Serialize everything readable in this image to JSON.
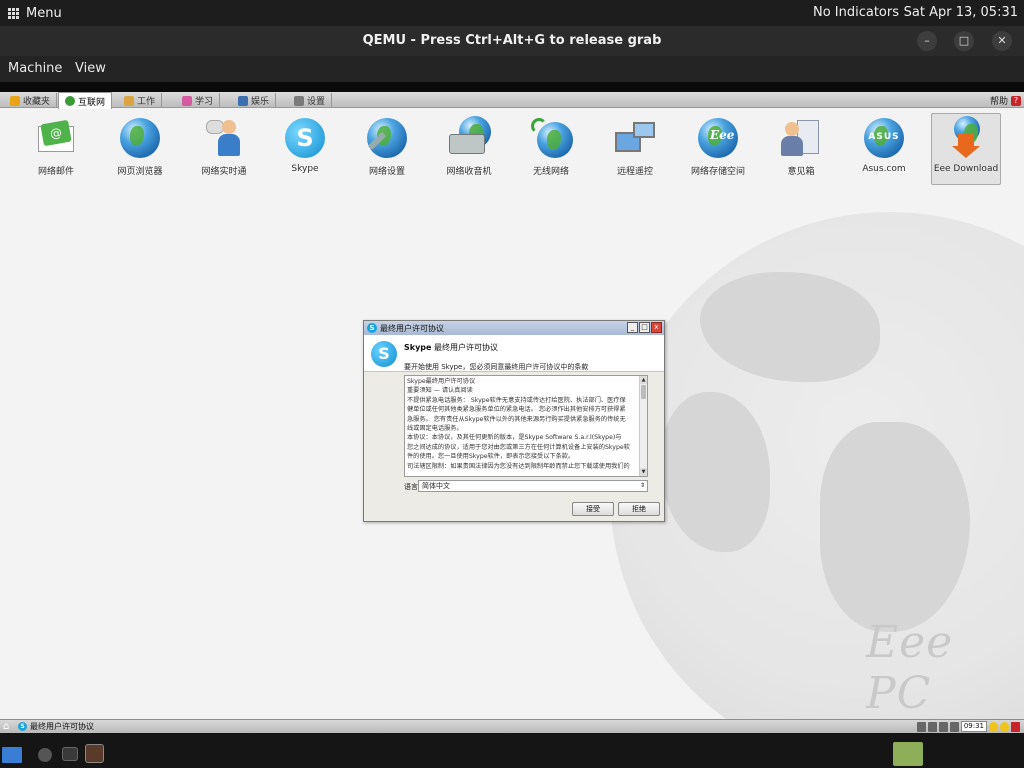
{
  "host_panel": {
    "menu_label": "Menu",
    "indicators": "No Indicators",
    "clock": "Sat Apr 13, 05:31"
  },
  "qemu": {
    "title": "QEMU - Press Ctrl+Alt+G to release grab",
    "minimize": "–",
    "restore": "□",
    "close": "✕",
    "menu": [
      "Machine",
      "View"
    ]
  },
  "eee_tabs": [
    {
      "label": "收藏夹",
      "icon": "star-icon",
      "color": "#e8a317"
    },
    {
      "label": "互联网",
      "icon": "globe-icon",
      "color": "#3a9a36",
      "active": true
    },
    {
      "label": "工作",
      "icon": "folder-icon",
      "color": "#d9a441"
    },
    {
      "label": "学习",
      "icon": "book-icon",
      "color": "#d55aa0"
    },
    {
      "label": "娱乐",
      "icon": "media-icon",
      "color": "#3b6fb0"
    },
    {
      "label": "设置",
      "icon": "wrench-icon",
      "color": "#7a7a7a"
    }
  ],
  "help_label": "帮助",
  "help_icon": "?",
  "apps": [
    {
      "label": "网络邮件",
      "icon": "mail-icon",
      "color": "#4fb24a"
    },
    {
      "label": "网页浏览器",
      "icon": "browser-globe-icon",
      "color": "#2b7fc4"
    },
    {
      "label": "网络实时通",
      "icon": "messenger-icon",
      "color": "#3a7dc9"
    },
    {
      "label": "Skype",
      "icon": "skype-icon",
      "color": "#19a4e0"
    },
    {
      "label": "网络设置",
      "icon": "network-settings-icon",
      "color": "#2b7fc4"
    },
    {
      "label": "网络收音机",
      "icon": "radio-icon",
      "color": "#2b7fc4"
    },
    {
      "label": "无线网络",
      "icon": "wireless-icon",
      "color": "#3aa43a"
    },
    {
      "label": "远程遥控",
      "icon": "remote-desktop-icon",
      "color": "#3a7dc9"
    },
    {
      "label": "网络存储空间",
      "icon": "eee-storage-icon",
      "color": "#2b7fc4"
    },
    {
      "label": "意见箱",
      "icon": "feedback-icon",
      "color": "#6a7fa8"
    },
    {
      "label": "Asus.com",
      "icon": "asus-globe-icon",
      "color": "#2b7fc4"
    },
    {
      "label": "Eee Download",
      "icon": "download-icon",
      "color": "#e8691e",
      "selected": true
    }
  ],
  "dialog": {
    "title": "最终用户许可协议",
    "head_brand": "Skype",
    "head_title": "最终用户许可协议",
    "subtitle": "要开始使用 Skype，您必须同意最终用户许可协议中的条款",
    "license_lines": [
      "Skype最终用户许可协议",
      "重要须知 — 请认真阅读",
      "不提供紧急电话服务： Skype软件无意支持或传达打给医院、执法部门、医疗保",
      "健单位或任何其他类紧急服务单位的紧急电话。 您必须作出其他安排方可获得紧",
      "急服务。 您有责任从Skype软件以外的其他来源另行购买提供紧急服务的传统无",
      "线或固定电话服务。",
      "本协议：本协议，及其任何更新的版本，是Skype Software S.a.r.l(Skype)与",
      "您之间达成的协议，适用于您对由您或第三方在任何计算机设备上安装的Skype软",
      "件的使用。您一旦使用Skype软件，即表示您接受以下条款。",
      "司法辖区限制：如果贵国法律因为您没有达到限制年龄而禁止您下载或使用我们的"
    ],
    "language_label": "语言",
    "language_value": "简体中文",
    "accept_label": "接受",
    "decline_label": "拒绝"
  },
  "taskbar": {
    "task_label": "最终用户许可协议",
    "time": "09:31"
  },
  "brand_logo": "Eee PC"
}
